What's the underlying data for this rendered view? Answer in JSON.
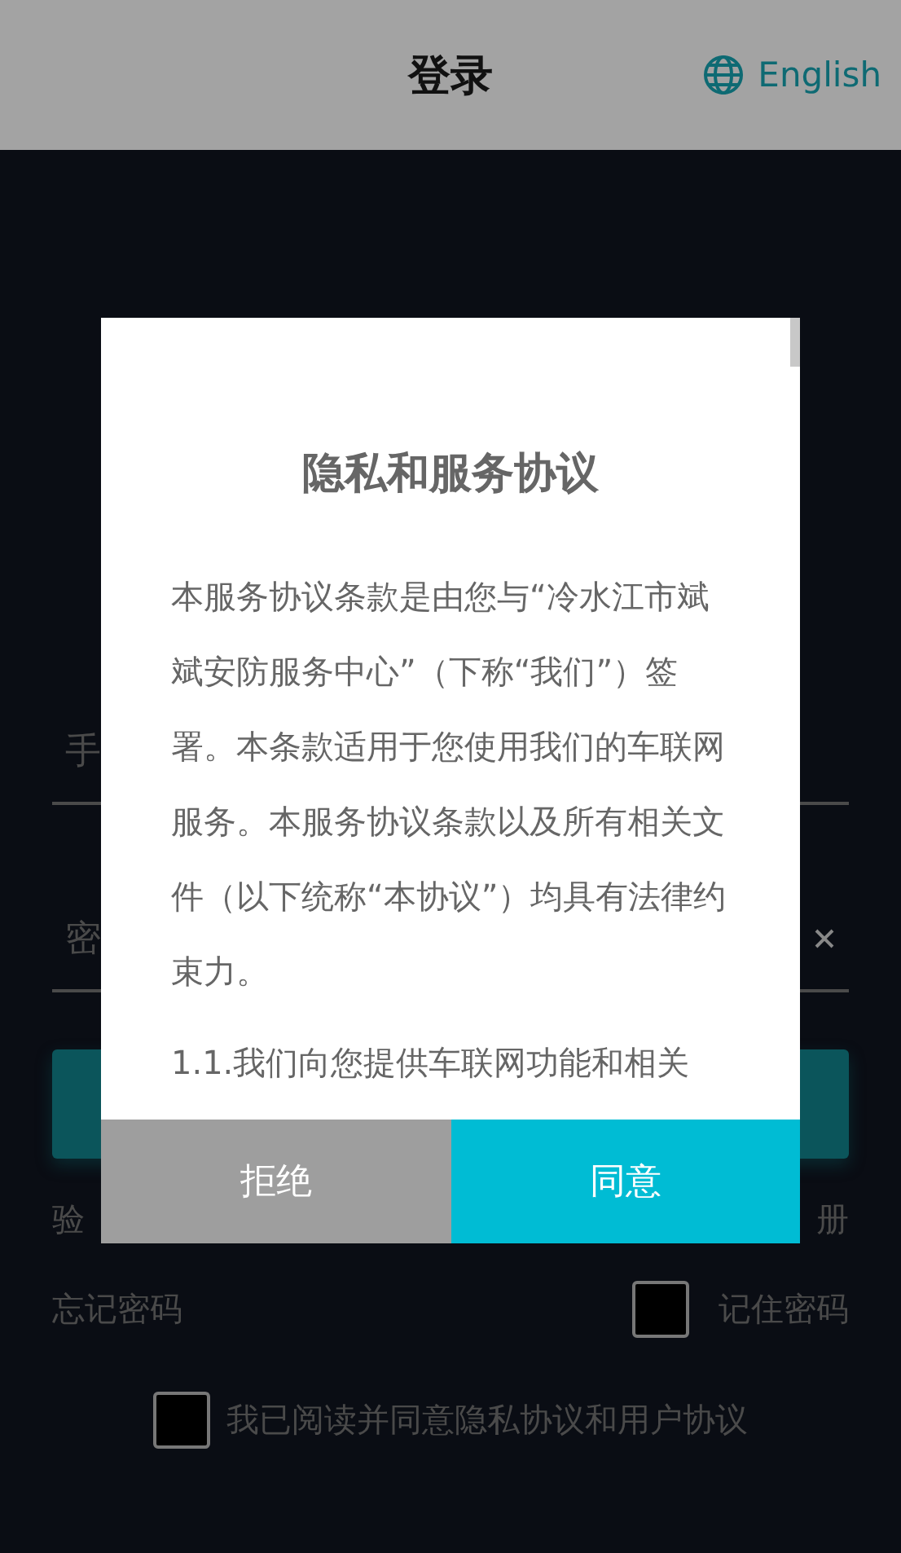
{
  "header": {
    "title": "登录",
    "language": "English"
  },
  "form": {
    "phone_placeholder": "手",
    "password_placeholder": "密",
    "link_left": "验",
    "link_right": "册",
    "forgot_password": "忘记密码",
    "remember": {
      "label": "记住密码",
      "checked": false
    },
    "agreement": {
      "label": "我已阅读并同意隐私协议和用户协议",
      "checked": false
    }
  },
  "dialog": {
    "title": "隐私和服务协议",
    "paragraphs": [
      "本服务协议条款是由您与“冷水江市斌斌安防服务中心”（下称“我们”）签署。本条款适用于您使用我们的车联网服务。本服务协议条款以及所有相关文件（以下统称“本协议”）均具有法律约束力。",
      "1.1.我们向您提供车联网功能和相关"
    ],
    "buttons": [
      {
        "label": "拒绝",
        "kind": "decline"
      },
      {
        "label": "同意",
        "kind": "accept"
      }
    ]
  }
}
